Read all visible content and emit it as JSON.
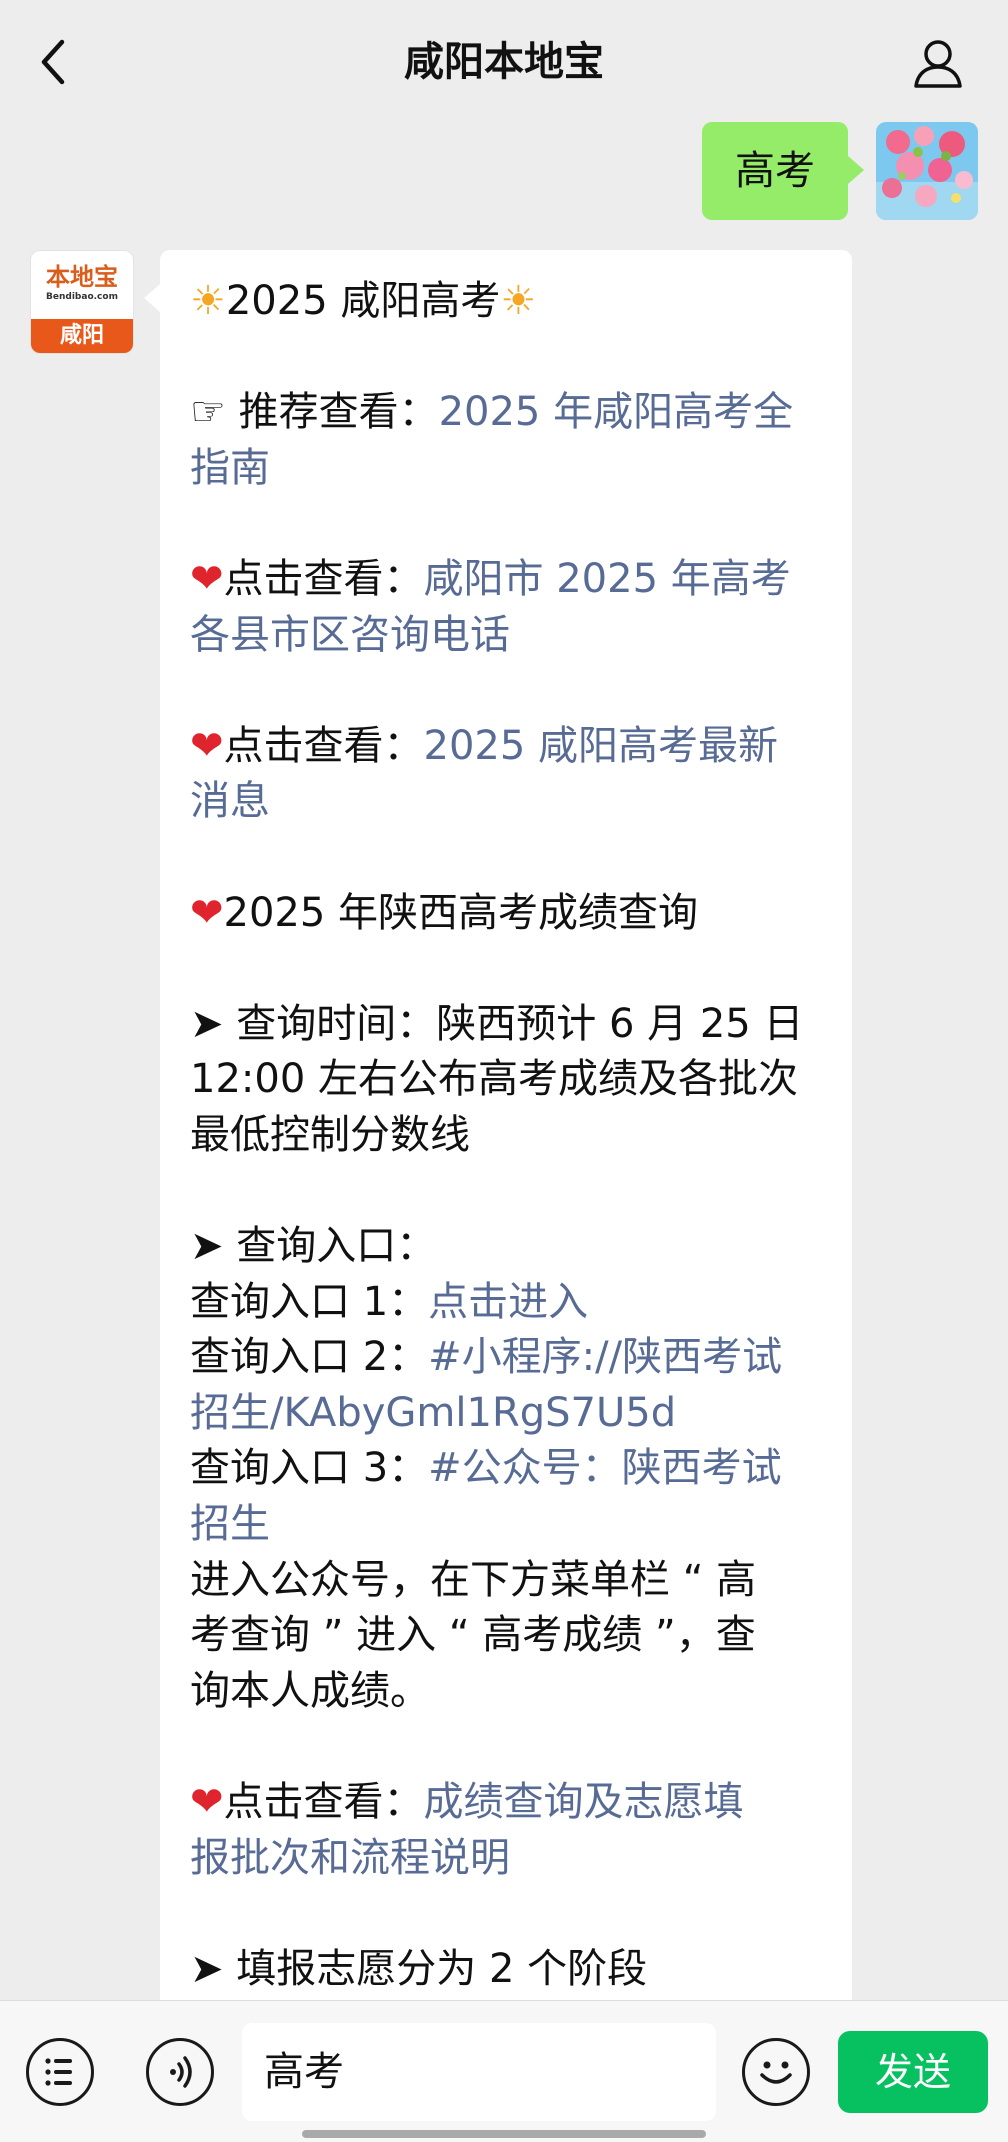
{
  "header": {
    "title": "咸阳本地宝"
  },
  "conversation": {
    "user_message": "高考",
    "bot_avatar": {
      "logo_text": "本地宝",
      "logo_sub": "Bendibao.com",
      "city": "咸阳"
    }
  },
  "message": {
    "title": "2025 咸阳高考",
    "rec_label": "推荐查看：",
    "rec_link_1": "2025 年咸阳高考全",
    "rec_link_2": "指南",
    "click1_label": "点击查看：",
    "click1_link_1": "咸阳市 2025 年高考",
    "click1_link_2": "各县市区咨询电话",
    "click2_label": "点击查看：",
    "click2_link_1": "2025 咸阳高考最新",
    "click2_link_2": "消息",
    "score_heading": "2025 年陕西高考成绩查询",
    "query_time_1": "查询时间：陕西预计 6 月 25 日",
    "query_time_2": "12:00 左右公布高考成绩及各批次",
    "query_time_3": "最低控制分数线",
    "entry_heading": "查询入口：",
    "entry1_label": "查询入口 1：",
    "entry1_link": "点击进入",
    "entry2_label": "查询入口 2：",
    "entry2_link_1": "#小程序://陕西考试",
    "entry2_link_2": "招生/KAbyGml1RgS7U5d",
    "entry3_label": "查询入口 3：",
    "entry3_link_1": "#公众号：陕西考试",
    "entry3_link_2": "招生",
    "entry_note_1": "进入公众号，在下方菜单栏 “ 高",
    "entry_note_2": "考查询 ” 进入 “ 高考成绩 ”，查",
    "entry_note_3": "询本人成绩。",
    "click3_label": "点击查看：",
    "click3_link_1": "成绩查询及志愿填",
    "click3_link_2": "报批次和流程说明",
    "stage_heading": "填报志愿分为 2 个阶段"
  },
  "input_bar": {
    "value": "高考",
    "send_label": "发送"
  },
  "icons": {
    "back": "chevron-left-icon",
    "profile": "person-icon",
    "menu": "list-icon",
    "voice": "voice-icon",
    "emoji": "smile-icon",
    "sun": "sun-emoji",
    "heart": "heart-emoji",
    "arrow": "arrowhead"
  },
  "colors": {
    "link": "#576b95",
    "user_bubble": "#95ec69",
    "send": "#07c160",
    "background": "#ededed"
  }
}
